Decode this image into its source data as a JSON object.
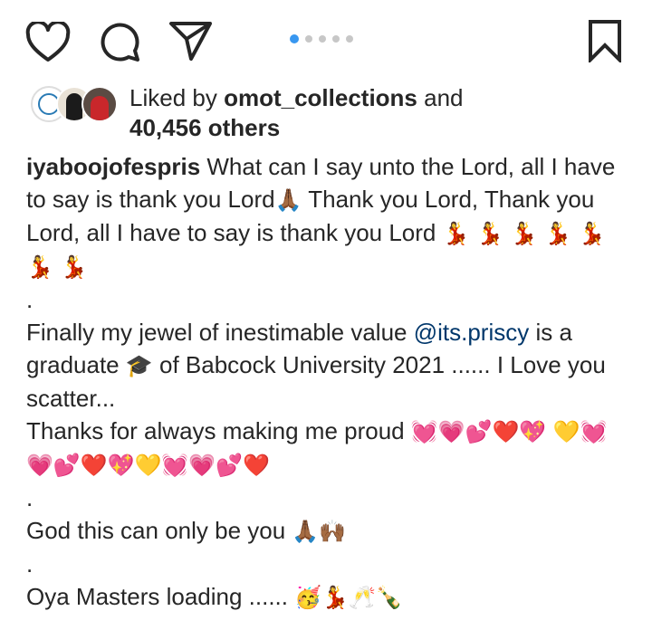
{
  "actions": {
    "like_icon": "heart-outline",
    "comment_icon": "speech-bubble",
    "share_icon": "paper-plane",
    "save_icon": "bookmark",
    "carousel_total": 5,
    "carousel_active": 1,
    "accent": "#3897f0"
  },
  "likes": {
    "prefix": "Liked by ",
    "user": "omot_collections",
    "conjunction": " and",
    "others": "40,456 others"
  },
  "caption": {
    "username": "iyaboojofespris",
    "line1": " What can I say unto the Lord, all I have to say is thank you Lord",
    "line1_emoji": "🙏🏾",
    "line1b": " Thank you Lord, Thank you Lord, all I have to say is thank you Lord ",
    "dance_emojis": "💃 💃 💃 💃 💃 💃 💃",
    "dot1": ".",
    "p2_a": "Finally my jewel of inestimable value ",
    "mention": "@its.priscy",
    "p2_b": " is a graduate ",
    "grad_emoji": "🎓",
    "p2_c": " of Babcock University 2021 ...... I Love you scatter...",
    "p3": "Thanks for always making me proud ",
    "hearts": "💓💗💕❤️💖 💛💓💗💕❤️💖💛💓💗💕❤️",
    "dot2": ".",
    "p4": "God this can only be you ",
    "p4_emoji": "🙏🏾🙌🏾",
    "dot3": ".",
    "p5": "Oya Masters loading ...... ",
    "p5_emoji": "🥳💃🥂🍾"
  }
}
